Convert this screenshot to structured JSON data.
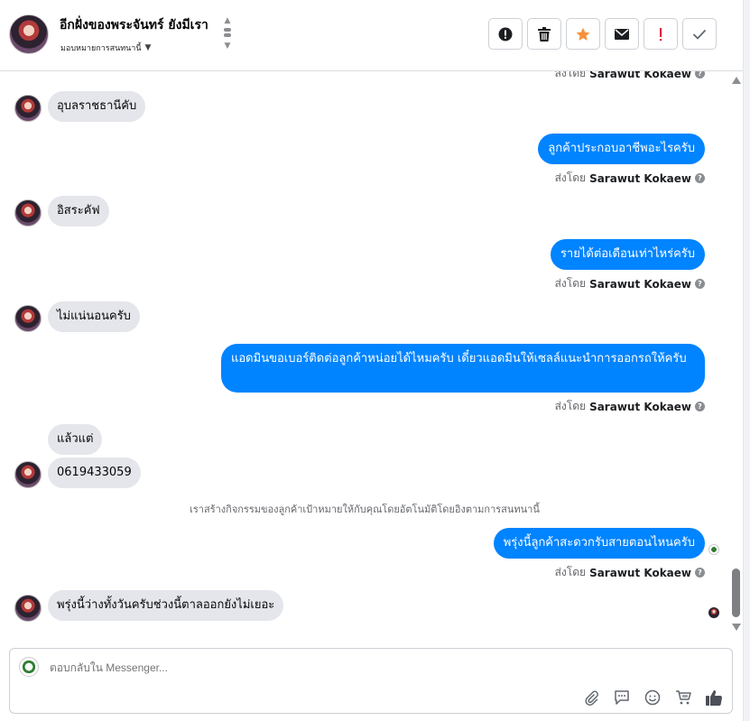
{
  "header": {
    "title": "อีกฝั่งของพระจันทร์ ยังมีเรา",
    "subtitle": "มอบหมายการสนทนานี้",
    "toolbar": [
      {
        "icon": "exclamation-circle-icon"
      },
      {
        "icon": "trash-icon"
      },
      {
        "icon": "star-icon",
        "color": "#f7923a"
      },
      {
        "icon": "envelope-icon"
      },
      {
        "icon": "spam-icon",
        "color": "#e41e3f"
      },
      {
        "icon": "check-icon"
      }
    ]
  },
  "messages": {
    "top_sentby_prefix": "ส่งโดย",
    "top_sentby_name": "Sarawut Kokaew",
    "m1": "อุบลราชธานีคับ",
    "m2": "ลูกค้าประกอบอาชีพอะไรครับ",
    "m2_sentby_prefix": "ส่งโดย",
    "m2_sentby_name": "Sarawut Kokaew",
    "m3": "อิสระคัฟ",
    "m4": "รายได้ต่อเดือนเท่าไหร่ครับ",
    "m4_sentby_prefix": "ส่งโดย",
    "m4_sentby_name": "Sarawut Kokaew",
    "m5": "ไม่แน่นอนครับ",
    "m6": "แอดมินขอเบอร์ติดต่อลูกค้าหน่อยได้ไหมครับ เดี๋ยวแอดมินให้เซลล์แนะนำการออกรถให้ครับ",
    "m6_sentby_prefix": "ส่งโดย",
    "m6_sentby_name": "Sarawut Kokaew",
    "m7": "แล้วแต่",
    "m8": "0619433059",
    "system": "เราสร้างกิจกรรมของลูกค้าเป้าหมายให้กับคุณโดยอัตโนมัติโดยอิงตามการสนทนานี้",
    "m9": "พรุ่งนี้ลูกค้าสะดวกรับสายตอนไหนครับ",
    "m9_sentby_prefix": "ส่งโดย",
    "m9_sentby_name": "Sarawut Kokaew",
    "m10": "พรุ่งนี้ว่างทั้งวันครับช่วงนี้ตาลออกยังไม่เยอะ"
  },
  "composer": {
    "placeholder": "ตอบกลับใน Messenger...",
    "icons": [
      "paperclip-icon",
      "chat-bubble-icon",
      "smiley-icon",
      "cart-icon",
      "thumbs-up-icon"
    ]
  },
  "colors": {
    "outgoing": "#0084ff",
    "incoming": "#e4e6eb"
  }
}
